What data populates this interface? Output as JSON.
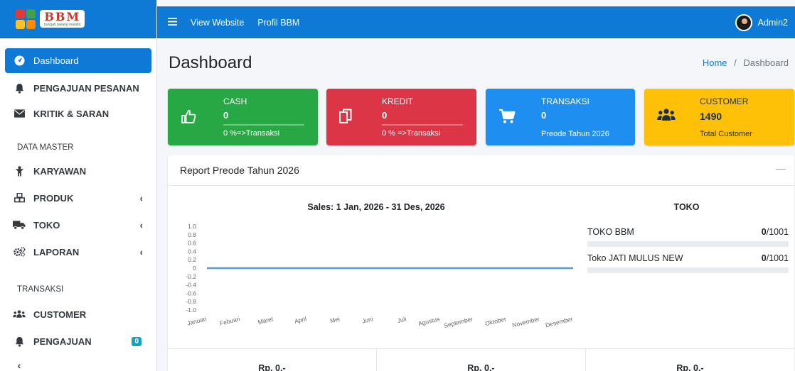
{
  "brand": {
    "logo_big": "BBM",
    "logo_small": "bungah barang mandiri"
  },
  "topbar": {
    "view_website": "View Website",
    "profil": "Profil BBM",
    "user_name": "Admin2"
  },
  "sidebar": {
    "items_top": [
      {
        "label": "Dashboard",
        "icon": "dashboard-icon"
      },
      {
        "label": "PENGAJUAN PESANAN",
        "icon": "bell-icon"
      },
      {
        "label": "KRITIK & SARAN",
        "icon": "envelope-icon"
      }
    ],
    "header_master": "DATA MASTER",
    "items_master": [
      {
        "label": "KARYAWAN",
        "icon": "person-icon"
      },
      {
        "label": "PRODUK",
        "icon": "cubes-icon"
      },
      {
        "label": "TOKO",
        "icon": "truck-icon"
      },
      {
        "label": "LAPORAN",
        "icon": "cogs-icon"
      }
    ],
    "header_transaksi": "TRANSAKSI",
    "items_transaksi": [
      {
        "label": "CUSTOMER",
        "icon": "users-icon"
      },
      {
        "label": "PENGAJUAN",
        "icon": "bell-icon",
        "badge": "0"
      }
    ]
  },
  "page": {
    "title": "Dashboard",
    "breadcrumb_home": "Home",
    "breadcrumb_sep": "/",
    "breadcrumb_current": "Dashboard"
  },
  "info_boxes": {
    "cash": {
      "title": "CASH",
      "value": "0",
      "desc": "0 %=>Transaksi",
      "color": "#28a745",
      "icon": "thumbs-up-icon"
    },
    "kredit": {
      "title": "KREDIT",
      "value": "0",
      "desc": "0 % =>Transaksi",
      "color": "#dc3545",
      "icon": "copy-icon"
    },
    "transaksi": {
      "title": "TRANSAKSI",
      "value": "0",
      "desc": "Preode Tahun 2026",
      "color": "#1e8ff0",
      "icon": "cart-icon"
    },
    "customer": {
      "title": "CUSTOMER",
      "value": "1490",
      "desc": "Total Customer",
      "color": "#ffc107",
      "icon": "users-icon"
    }
  },
  "report": {
    "title": "Report Preode Tahun 2026",
    "collapse": "—",
    "sales_title": "Sales: 1 Jan, 2026 - 31 Des, 2026",
    "toko_title": "TOKO",
    "toko": [
      {
        "name": "TOKO BBM",
        "value": "0",
        "total": "/1001",
        "progress": 0
      },
      {
        "name": "Toko JATI MULUS NEW",
        "value": "0",
        "total": "/1001",
        "progress": 0
      }
    ],
    "footer": [
      "Rp. 0,-",
      "Rp. 0,-",
      "Rp. 0,-"
    ]
  },
  "chart_data": {
    "type": "line",
    "categories": [
      "Januari",
      "Febuari",
      "Maret",
      "April",
      "Mei",
      "Juni",
      "Juli",
      "Agustus",
      "September",
      "Oktober",
      "November",
      "Desember"
    ],
    "series": [
      {
        "values": [
          0,
          0,
          0,
          0,
          0,
          0,
          0,
          0,
          0,
          0,
          0,
          0
        ]
      }
    ],
    "ylim": [
      -1.0,
      1.0
    ],
    "yticks": [
      "1.0",
      "0.8",
      "0.6",
      "0.4",
      "0.2",
      "0",
      "-0.2",
      "-0.4",
      "-0.6",
      "-0.8",
      "-1.0"
    ],
    "line_color": "#5b9bd5",
    "grid": false
  }
}
